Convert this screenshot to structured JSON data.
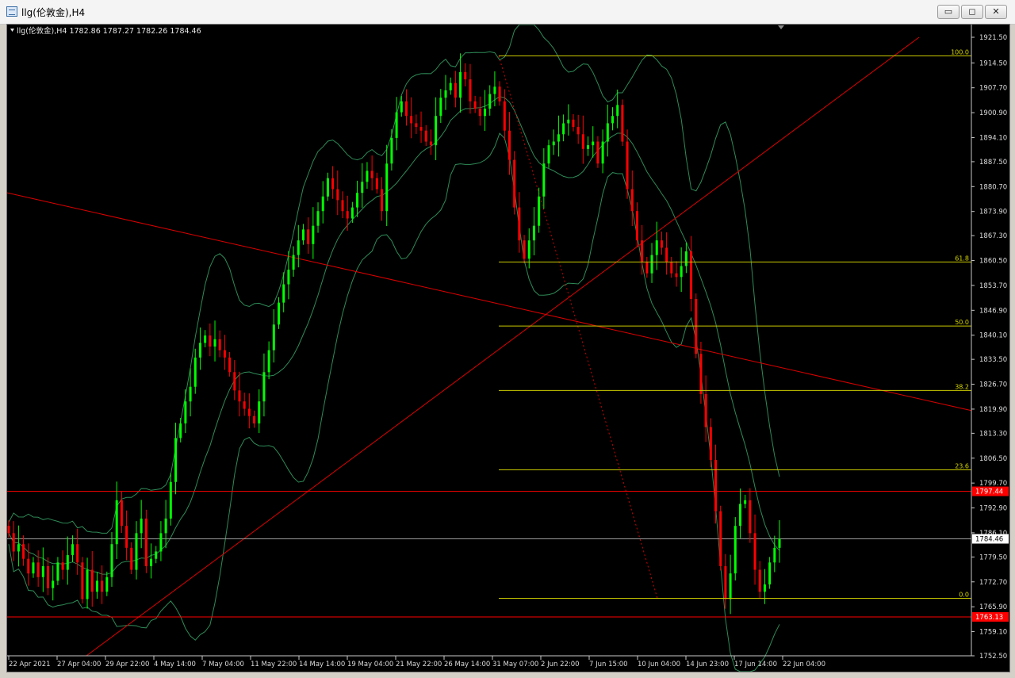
{
  "window": {
    "title": "llg(伦敦金),H4",
    "buttons": {
      "minimize": "▭",
      "restore": "◻",
      "close": "✕"
    }
  },
  "chart_header": "llg(伦敦金),H4  1782.86 1787.27 1782.26 1784.46",
  "chart_data": {
    "type": "candlestick",
    "symbol": "llg(伦敦金)",
    "timeframe": "H4",
    "ohlc": {
      "open": 1782.86,
      "high": 1787.27,
      "low": 1782.26,
      "close": 1784.46
    },
    "y_ticks": [
      1921.5,
      1914.5,
      1907.7,
      1900.9,
      1894.1,
      1887.5,
      1880.7,
      1873.9,
      1867.3,
      1860.5,
      1853.7,
      1846.9,
      1840.1,
      1833.5,
      1826.7,
      1819.9,
      1813.3,
      1806.5,
      1799.7,
      1792.9,
      1786.1,
      1779.5,
      1772.7,
      1765.9,
      1759.1,
      1752.5
    ],
    "ylim": [
      1752.5,
      1921.5
    ],
    "x_ticks": [
      "22 Apr 2021",
      "27 Apr 04:00",
      "29 Apr 22:00",
      "4 May 14:00",
      "7 May 04:00",
      "11 May 22:00",
      "14 May 14:00",
      "19 May 04:00",
      "21 May 22:00",
      "26 May 14:00",
      "31 May 07:00",
      "2 Jun 22:00",
      "7 Jun 15:00",
      "10 Jun 04:00",
      "14 Jun 23:00",
      "17 Jun 14:00",
      "22 Jun 04:00"
    ],
    "price_labels": {
      "current": "1784.46",
      "red_upper": "1797.44",
      "red_lower": "1763.13"
    },
    "price_levels": {
      "current": 1784.46,
      "red_upper": 1797.44,
      "red_lower": 1763.13
    },
    "fibo": {
      "levels": [
        {
          "label": "100.0",
          "price": 1916.4
        },
        {
          "label": "61.8",
          "price": 1860.1
        },
        {
          "label": "50.0",
          "price": 1842.6
        },
        {
          "label": "38.2",
          "price": 1825.0
        },
        {
          "label": "23.6",
          "price": 1803.3
        },
        {
          "label": "0.0",
          "price": 1768.2
        }
      ]
    },
    "closes": [
      1786,
      1781,
      1783,
      1779,
      1775,
      1778,
      1774,
      1777,
      1771,
      1773,
      1778,
      1776,
      1780,
      1783,
      1778,
      1768,
      1776,
      1770,
      1773,
      1770,
      1774,
      1783,
      1795,
      1788,
      1782,
      1776,
      1786,
      1790,
      1777,
      1779,
      1781,
      1786,
      1790,
      1800,
      1812,
      1816,
      1822,
      1826,
      1834,
      1838,
      1840,
      1837,
      1839,
      1836,
      1834,
      1830,
      1825,
      1822,
      1820,
      1818,
      1816,
      1822,
      1830,
      1836,
      1843,
      1849,
      1854,
      1858,
      1862,
      1866,
      1869,
      1865,
      1870,
      1874,
      1878,
      1883,
      1880,
      1877,
      1874,
      1872,
      1875,
      1879,
      1882,
      1885,
      1883,
      1880,
      1874,
      1887,
      1894,
      1901,
      1904,
      1900,
      1898,
      1897,
      1896,
      1893,
      1892,
      1900,
      1905,
      1907,
      1909,
      1905,
      1912,
      1910,
      1904,
      1902,
      1900,
      1902,
      1906,
      1908,
      1904,
      1896,
      1888,
      1875,
      1866,
      1861,
      1866,
      1870,
      1878,
      1887,
      1892,
      1893,
      1895,
      1898,
      1899,
      1897,
      1895,
      1891,
      1892,
      1893,
      1887,
      1893,
      1898,
      1900,
      1903,
      1893,
      1880,
      1874,
      1866,
      1860,
      1857,
      1862,
      1866,
      1864,
      1860,
      1857,
      1856,
      1859,
      1863,
      1850,
      1835,
      1824,
      1815,
      1806,
      1792,
      1777,
      1768,
      1775,
      1788,
      1794,
      1795,
      1786,
      1776,
      1770,
      1772,
      1778,
      1782,
      1784.46
    ]
  }
}
